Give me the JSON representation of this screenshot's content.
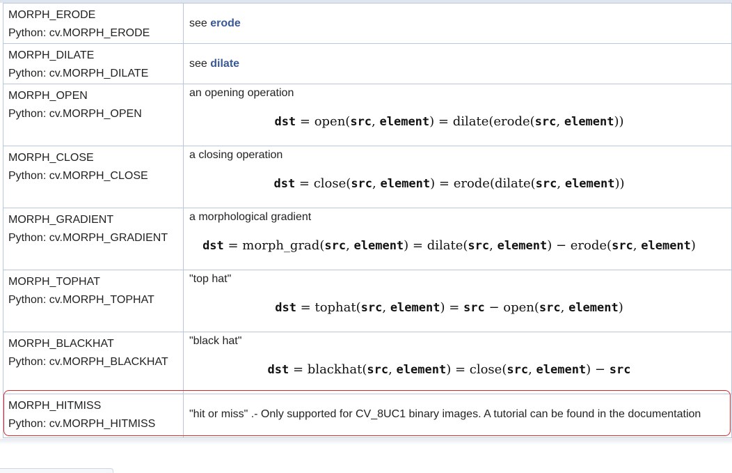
{
  "rows": [
    {
      "name": "MORPH_ERODE",
      "python": "Python: cv.MORPH_ERODE",
      "desc": "see ",
      "link": "erode",
      "formula": null
    },
    {
      "name": "MORPH_DILATE",
      "python": "Python: cv.MORPH_DILATE",
      "desc": "see ",
      "link": "dilate",
      "formula": null
    },
    {
      "name": "MORPH_OPEN",
      "python": "Python: cv.MORPH_OPEN",
      "desc": "an opening operation",
      "link": null,
      "formula": [
        [
          "v",
          "dst"
        ],
        [
          "t",
          " = open("
        ],
        [
          "v",
          "src"
        ],
        [
          "t",
          ", "
        ],
        [
          "v",
          "element"
        ],
        [
          "t",
          ") = dilate(erode("
        ],
        [
          "v",
          "src"
        ],
        [
          "t",
          ", "
        ],
        [
          "v",
          "element"
        ],
        [
          "t",
          "))"
        ]
      ]
    },
    {
      "name": "MORPH_CLOSE",
      "python": "Python: cv.MORPH_CLOSE",
      "desc": "a closing operation",
      "link": null,
      "formula": [
        [
          "v",
          "dst"
        ],
        [
          "t",
          " = close("
        ],
        [
          "v",
          "src"
        ],
        [
          "t",
          ", "
        ],
        [
          "v",
          "element"
        ],
        [
          "t",
          ") = erode(dilate("
        ],
        [
          "v",
          "src"
        ],
        [
          "t",
          ", "
        ],
        [
          "v",
          "element"
        ],
        [
          "t",
          "))"
        ]
      ]
    },
    {
      "name": "MORPH_GRADIENT",
      "python": "Python: cv.MORPH_GRADIENT",
      "desc": "a morphological gradient",
      "link": null,
      "formula": [
        [
          "v",
          "dst"
        ],
        [
          "t",
          " = morph_grad("
        ],
        [
          "v",
          "src"
        ],
        [
          "t",
          ", "
        ],
        [
          "v",
          "element"
        ],
        [
          "t",
          ") = dilate("
        ],
        [
          "v",
          "src"
        ],
        [
          "t",
          ", "
        ],
        [
          "v",
          "element"
        ],
        [
          "t",
          ") − erode("
        ],
        [
          "v",
          "src"
        ],
        [
          "t",
          ", "
        ],
        [
          "v",
          "element"
        ],
        [
          "t",
          ")"
        ]
      ]
    },
    {
      "name": "MORPH_TOPHAT",
      "python": "Python: cv.MORPH_TOPHAT",
      "desc": "\"top hat\"",
      "link": null,
      "formula": [
        [
          "v",
          "dst"
        ],
        [
          "t",
          " = tophat("
        ],
        [
          "v",
          "src"
        ],
        [
          "t",
          ", "
        ],
        [
          "v",
          "element"
        ],
        [
          "t",
          ") = "
        ],
        [
          "v",
          "src"
        ],
        [
          "t",
          " − open("
        ],
        [
          "v",
          "src"
        ],
        [
          "t",
          ", "
        ],
        [
          "v",
          "element"
        ],
        [
          "t",
          ")"
        ]
      ]
    },
    {
      "name": "MORPH_BLACKHAT",
      "python": "Python: cv.MORPH_BLACKHAT",
      "desc": "\"black hat\"",
      "link": null,
      "formula": [
        [
          "v",
          "dst"
        ],
        [
          "t",
          " = blackhat("
        ],
        [
          "v",
          "src"
        ],
        [
          "t",
          ", "
        ],
        [
          "v",
          "element"
        ],
        [
          "t",
          ") = close("
        ],
        [
          "v",
          "src"
        ],
        [
          "t",
          ", "
        ],
        [
          "v",
          "element"
        ],
        [
          "t",
          ") − "
        ],
        [
          "v",
          "src"
        ]
      ]
    },
    {
      "name": "MORPH_HITMISS",
      "python": "Python: cv.MORPH_HITMISS",
      "desc": "\"hit or miss\" .- Only supported for CV_8UC1 binary images. A tutorial can be found in the documentation",
      "link": null,
      "formula": null
    }
  ],
  "colors": {
    "link": "#3a5894",
    "border": "#b8c6df",
    "highlight": "#d62828"
  }
}
